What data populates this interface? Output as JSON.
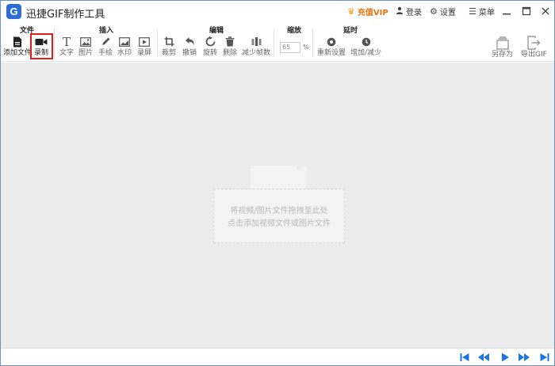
{
  "window": {
    "title": "迅捷GIF制作工具",
    "logo_letter": "G"
  },
  "titlebar": {
    "vip_label": "充值VIP",
    "login_label": "登录",
    "settings_label": "设置",
    "menu_label": "菜单"
  },
  "toolbar": {
    "groups": {
      "file": "文件",
      "insert": "插入",
      "edit": "编辑",
      "zoom": "缩放",
      "delay": "延时"
    },
    "file": {
      "add_file": "添加文件",
      "record": "录制"
    },
    "insert": {
      "text": "文字",
      "image": "图片",
      "draw": "手绘",
      "watermark": "水印",
      "record_screen": "录屏"
    },
    "edit": {
      "crop": "裁剪",
      "undo": "撤销",
      "rotate": "旋转",
      "delete": "删除",
      "reduce_frames": "减少帧数"
    },
    "zoom": {
      "value": "65",
      "unit": "%"
    },
    "delay": {
      "reset": "重新设置",
      "increase_decrease": "增加/减少"
    },
    "right": {
      "save_as": "另存为",
      "export_gif": "导出GIF"
    }
  },
  "canvas": {
    "drop_hint_line1": "将视频/图片文件拖拽至此处",
    "drop_hint_line2": "点击添加视频文件或图片文件"
  },
  "colors": {
    "accent": "#1a75e0",
    "highlight_border": "#e01d1d",
    "vip": "#e8700d",
    "canvas_bg": "#ececec"
  }
}
